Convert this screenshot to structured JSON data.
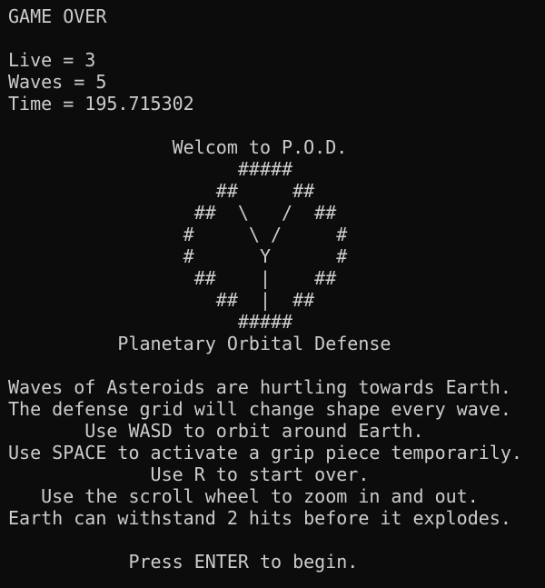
{
  "terminal": {
    "lines": [
      "GAME OVER",
      "",
      "Live = 3",
      "Waves = 5",
      "Time = 195.715302",
      "",
      "               Welcom to P.O.D.",
      "                     #####",
      "                   ##     ##",
      "                 ##  \\   /  ##",
      "                #     \\ /     #",
      "                #      Y      #",
      "                 ##    |    ##",
      "                   ##  |  ##",
      "                     #####",
      "          Planetary Orbital Defense",
      "",
      "Waves of Asteroids are hurtling towards Earth.",
      "The defense grid will change shape every wave.",
      "       Use WASD to orbit around Earth.",
      "Use SPACE to activate a grip piece temporarily.",
      "             Use R to start over.",
      "   Use the scroll wheel to zoom in and out.",
      "Earth can withstand 2 hits before it explodes.",
      "",
      "           Press ENTER to begin."
    ]
  }
}
